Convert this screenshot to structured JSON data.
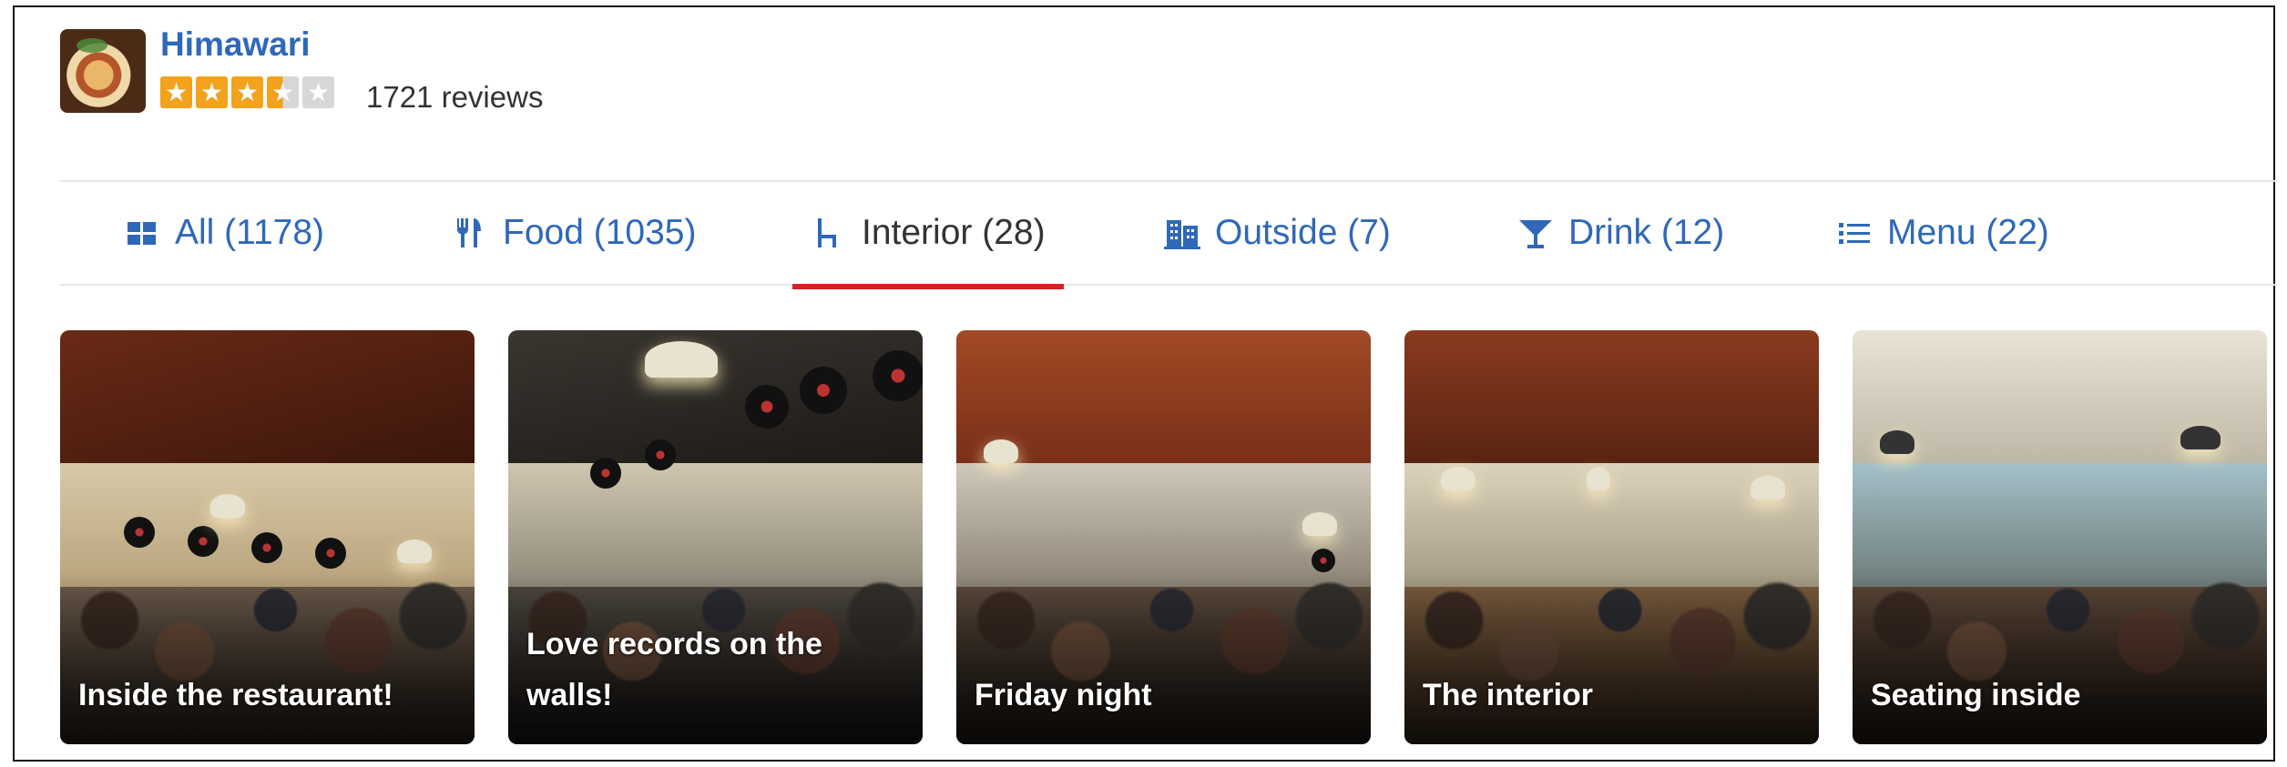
{
  "business": {
    "name": "Himawari",
    "rating": 3.5,
    "rating_max": 5,
    "review_count": "1721 reviews"
  },
  "tabs": [
    {
      "label": "All (1178)",
      "icon": "grid-icon",
      "active": false
    },
    {
      "label": "Food (1035)",
      "icon": "fork-knife-icon",
      "active": false
    },
    {
      "label": "Interior (28)",
      "icon": "chair-icon",
      "active": true
    },
    {
      "label": "Outside (7)",
      "icon": "building-icon",
      "active": false
    },
    {
      "label": "Drink (12)",
      "icon": "cocktail-icon",
      "active": false
    },
    {
      "label": "Menu (22)",
      "icon": "list-icon",
      "active": false
    }
  ],
  "photos": [
    {
      "caption": "Inside the restaurant!"
    },
    {
      "caption": "Love records on the walls!"
    },
    {
      "caption": "Friday night"
    },
    {
      "caption": "The interior"
    },
    {
      "caption": "Seating inside"
    }
  ],
  "colors": {
    "link_blue": "#2f68b9",
    "active_underline": "#d32323",
    "star_orange": "#f2a21c",
    "star_empty": "#d7d7d7"
  }
}
